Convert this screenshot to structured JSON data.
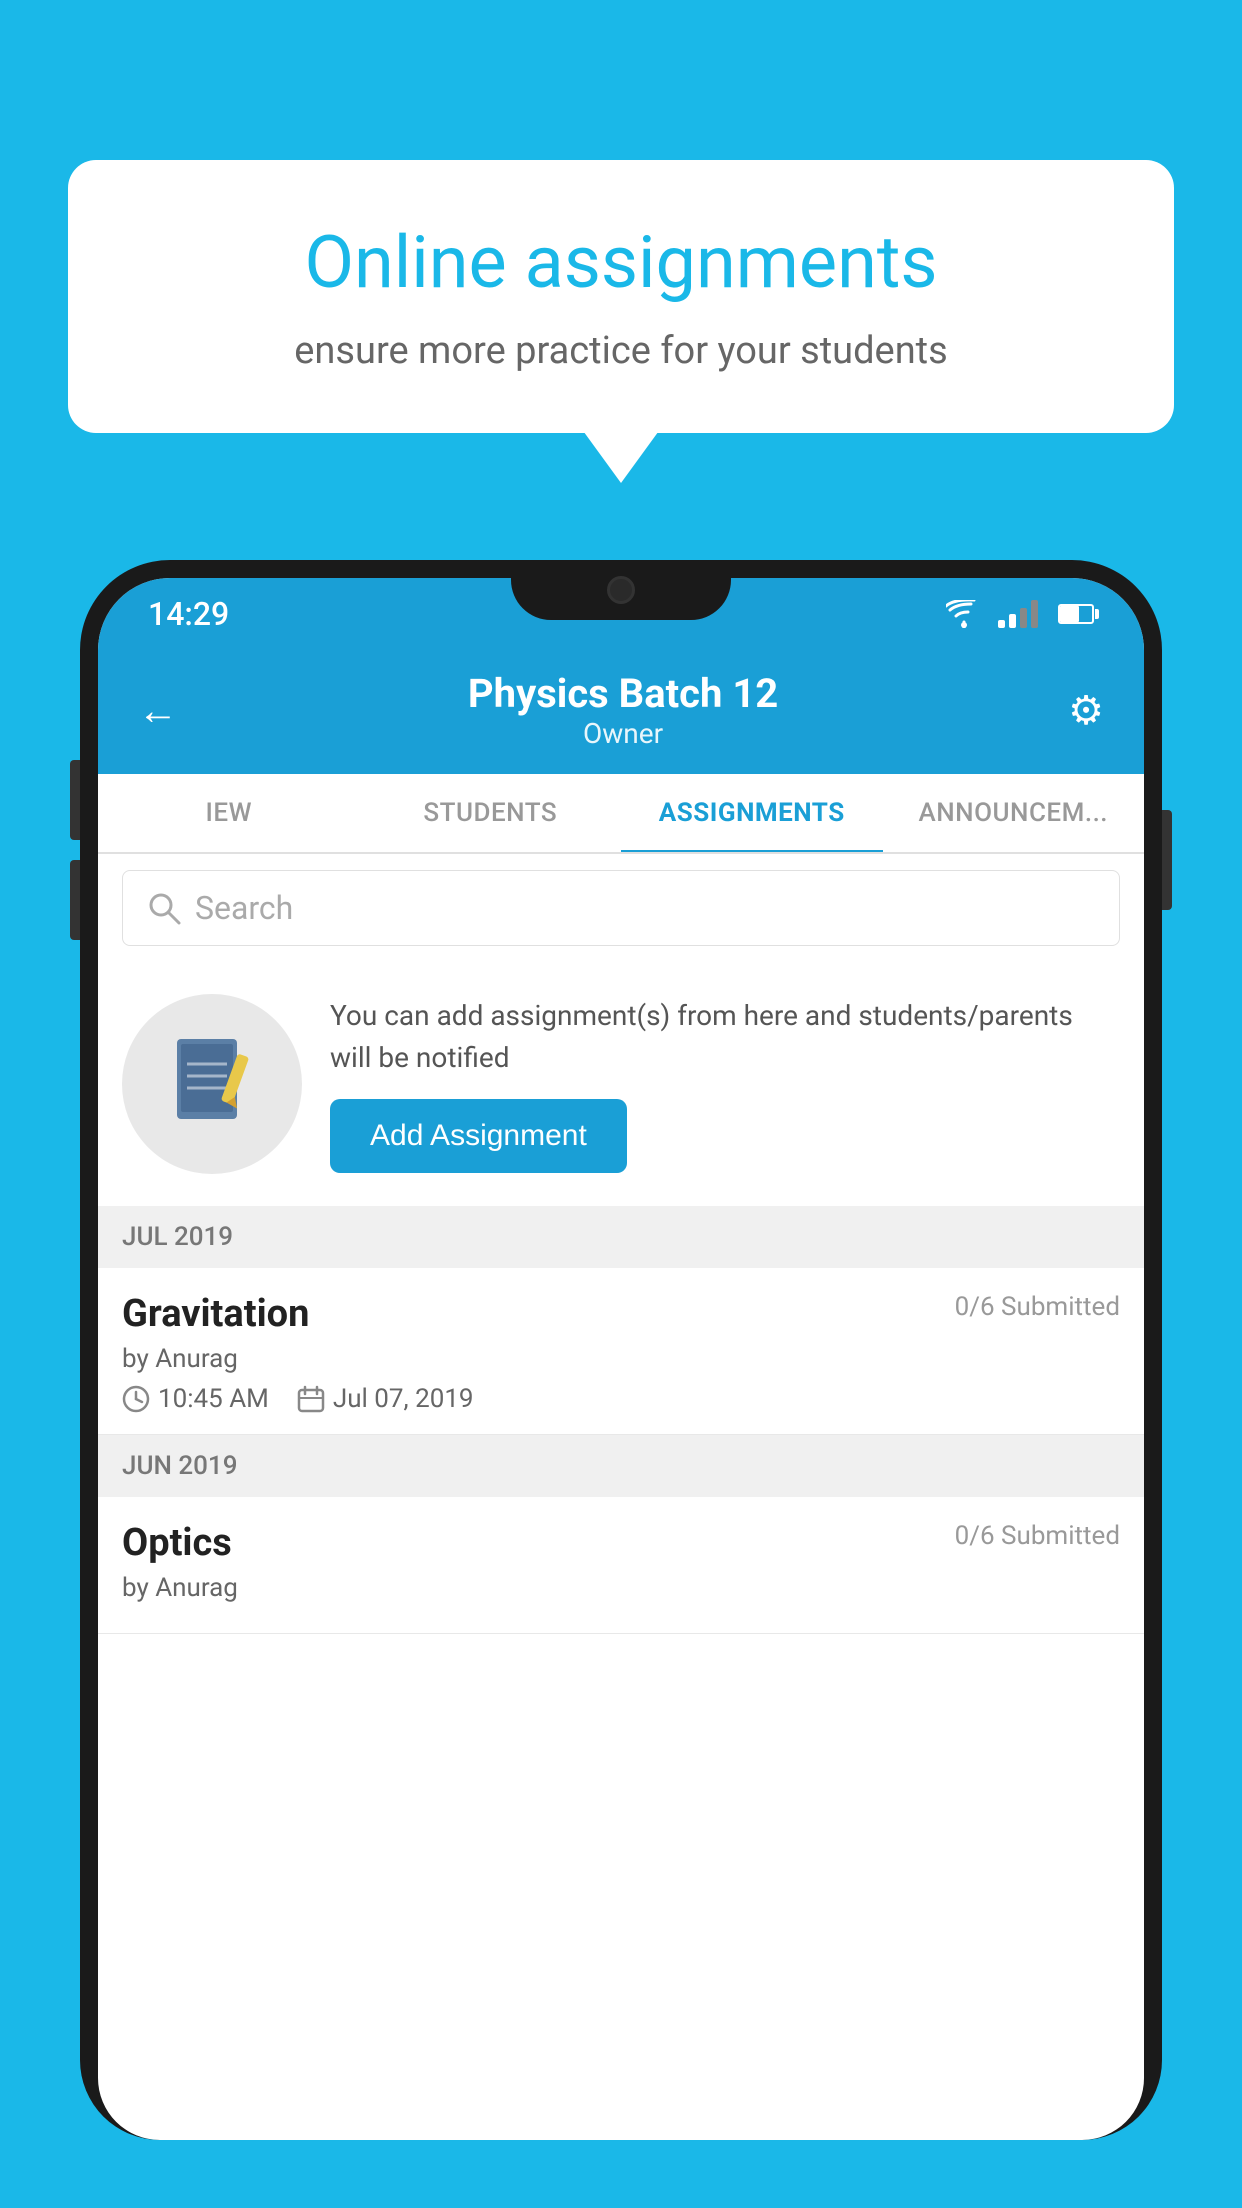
{
  "bubble": {
    "title": "Online assignments",
    "subtitle": "ensure more practice for your students"
  },
  "status_bar": {
    "time": "14:29",
    "wifi": "▾",
    "signal": "▲",
    "battery": "battery"
  },
  "header": {
    "back_label": "←",
    "title": "Physics Batch 12",
    "subtitle": "Owner",
    "gear_label": "⚙"
  },
  "tabs": [
    {
      "label": "IEW",
      "active": false
    },
    {
      "label": "STUDENTS",
      "active": false
    },
    {
      "label": "ASSIGNMENTS",
      "active": true
    },
    {
      "label": "ANNOUNCEM...",
      "active": false
    }
  ],
  "search": {
    "placeholder": "Search"
  },
  "info": {
    "description": "You can add assignment(s) from here and students/parents will be notified",
    "add_button_label": "Add Assignment"
  },
  "sections": [
    {
      "label": "JUL 2019",
      "assignments": [
        {
          "name": "Gravitation",
          "submitted": "0/6 Submitted",
          "author": "by Anurag",
          "time": "10:45 AM",
          "date": "Jul 07, 2019"
        }
      ]
    },
    {
      "label": "JUN 2019",
      "assignments": [
        {
          "name": "Optics",
          "submitted": "0/6 Submitted",
          "author": "by Anurag",
          "time": "",
          "date": ""
        }
      ]
    }
  ],
  "colors": {
    "primary": "#1a9fd6",
    "background": "#1ab8e8",
    "tab_active": "#1a9fd6"
  }
}
